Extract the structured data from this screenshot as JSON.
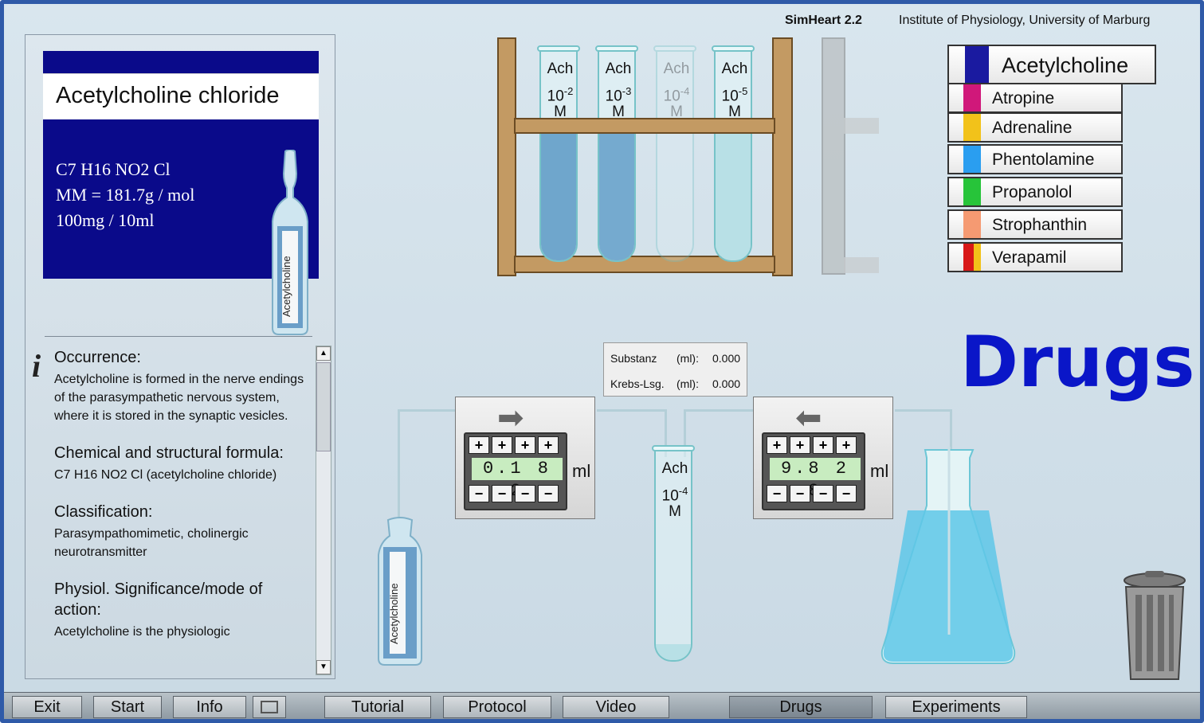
{
  "header": {
    "app": "SimHeart 2.2",
    "institution": "Institute of Physiology, University of Marburg"
  },
  "drug_card": {
    "title": "Acetylcholine chloride",
    "formula_lines": [
      "C7 H16 NO2 Cl",
      "MM = 181.7g / mol",
      "100mg / 10ml"
    ],
    "ampoule_label": "Acetylcholine"
  },
  "info": {
    "sections": [
      {
        "heading": "Occurrence:",
        "body": "Acetylcholine is formed in the nerve endings of the parasympathetic nervous system, where it is stored in the synaptic vesicles."
      },
      {
        "heading": "Chemical and structural formula:",
        "body": "C7 H16 NO2 Cl (acetylcholine chloride)"
      },
      {
        "heading": "Classification:",
        "body": "Parasympathomimetic, cholinergic neurotransmitter"
      },
      {
        "heading": "Physiol. Significance/mode of action:",
        "body": "Acetylcholine is the physiologic"
      }
    ]
  },
  "rack_tubes": [
    {
      "name": "Ach",
      "exp": "-2",
      "unit": "M"
    },
    {
      "name": "Ach",
      "exp": "-3",
      "unit": "M"
    },
    {
      "name": "Ach",
      "exp": "-4",
      "unit": "M"
    },
    {
      "name": "Ach",
      "exp": "-5",
      "unit": "M"
    }
  ],
  "drugs": {
    "selected": "Acetylcholine",
    "list": [
      "Atropine",
      "Adrenaline",
      "Phentolamine",
      "Propanolol",
      "Strophanthin",
      "Verapamil"
    ],
    "colors": [
      "#1a1aa0",
      "#d0187a",
      "#f2c21a",
      "#2a9ef0",
      "#27c43a",
      "#f59a72",
      "#d81818"
    ]
  },
  "title": "Drugs",
  "readout": {
    "substanz_label": "Substanz",
    "krebs_label": "Krebs-Lsg.",
    "unit": "(ml):",
    "substanz_value": "0.000",
    "krebs_value": "0.000"
  },
  "pump_left": {
    "digits": "0.1 8 2",
    "unit": "ml"
  },
  "pump_right": {
    "digits": "9.8 2 8",
    "unit": "ml"
  },
  "mix_tube": {
    "name": "Ach",
    "exp": "-4",
    "unit": "M"
  },
  "bottle_label": "Acetylcholine",
  "taskbar": [
    "Exit",
    "Start",
    "Info",
    "Tutorial",
    "Protocol",
    "Video",
    "Drugs",
    "Experiments"
  ]
}
